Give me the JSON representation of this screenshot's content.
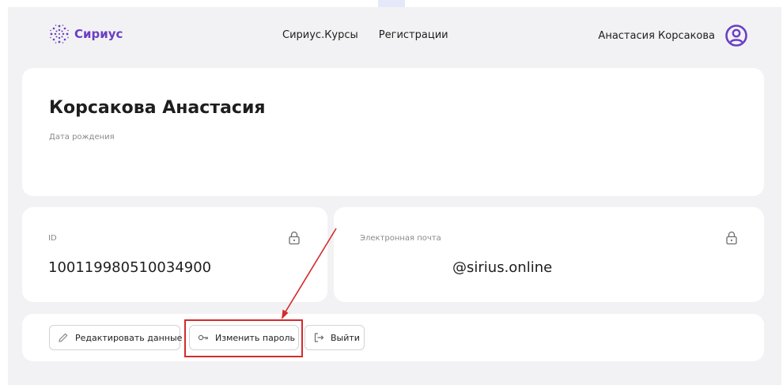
{
  "header": {
    "logo_text": "Сириус",
    "nav": [
      "Сириус.Курсы",
      "Регистрации"
    ],
    "user_name": "Анастасия Корсакова"
  },
  "profile": {
    "name": "Корсакова Анастасия",
    "dob_label": "Дата рождения"
  },
  "id_card": {
    "label": "ID",
    "value": "100119980510034900"
  },
  "email_card": {
    "label": "Электронная почта",
    "value": "@sirius.online"
  },
  "actions": {
    "edit_label": "Редактировать данные",
    "change_password_label": "Изменить пароль",
    "logout_label": "Выйти"
  },
  "colors": {
    "brand": "#6b3fc4",
    "annotation": "#d42b2b",
    "background": "#f2f2f4"
  }
}
